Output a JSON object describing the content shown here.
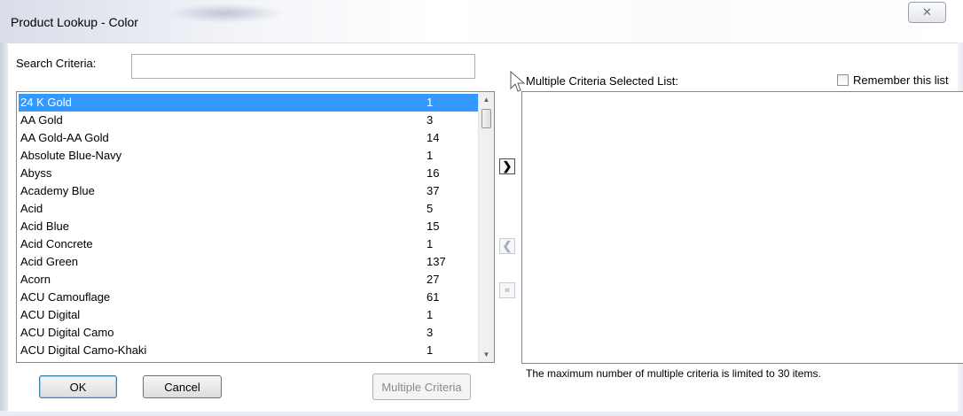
{
  "window": {
    "title": "Product Lookup - Color",
    "close_glyph": "✕"
  },
  "search": {
    "label": "Search Criteria:",
    "value": "",
    "placeholder": ""
  },
  "list": {
    "selected_index": 0,
    "items": [
      {
        "name": "24 K Gold",
        "count": "1"
      },
      {
        "name": "AA Gold",
        "count": "3"
      },
      {
        "name": "AA Gold-AA Gold",
        "count": "14"
      },
      {
        "name": "Absolute Blue-Navy",
        "count": "1"
      },
      {
        "name": "Abyss",
        "count": "16"
      },
      {
        "name": "Academy Blue",
        "count": "37"
      },
      {
        "name": "Acid",
        "count": "5"
      },
      {
        "name": "Acid Blue",
        "count": "15"
      },
      {
        "name": "Acid Concrete",
        "count": "1"
      },
      {
        "name": "Acid Green",
        "count": "137"
      },
      {
        "name": "Acorn",
        "count": "27"
      },
      {
        "name": "ACU Camouflage",
        "count": "61"
      },
      {
        "name": "ACU Digital",
        "count": "1"
      },
      {
        "name": "ACU Digital Camo",
        "count": "3"
      },
      {
        "name": "ACU Digital Camo-Khaki",
        "count": "1"
      }
    ]
  },
  "transfer": {
    "add_glyph": "❯",
    "remove_glyph": "❮",
    "remove_all_glyph": "«"
  },
  "selected_panel": {
    "title": "Multiple Criteria Selected List:",
    "remember_label": "Remember this list",
    "remember_checked": false,
    "note": "The maximum number of multiple criteria is limited to 30 items."
  },
  "buttons": {
    "ok": "OK",
    "cancel": "Cancel",
    "multiple_criteria": "Multiple Criteria"
  },
  "colors": {
    "selection": "#3399ff",
    "border": "#828790",
    "disabled_text": "#8a8a8a"
  }
}
